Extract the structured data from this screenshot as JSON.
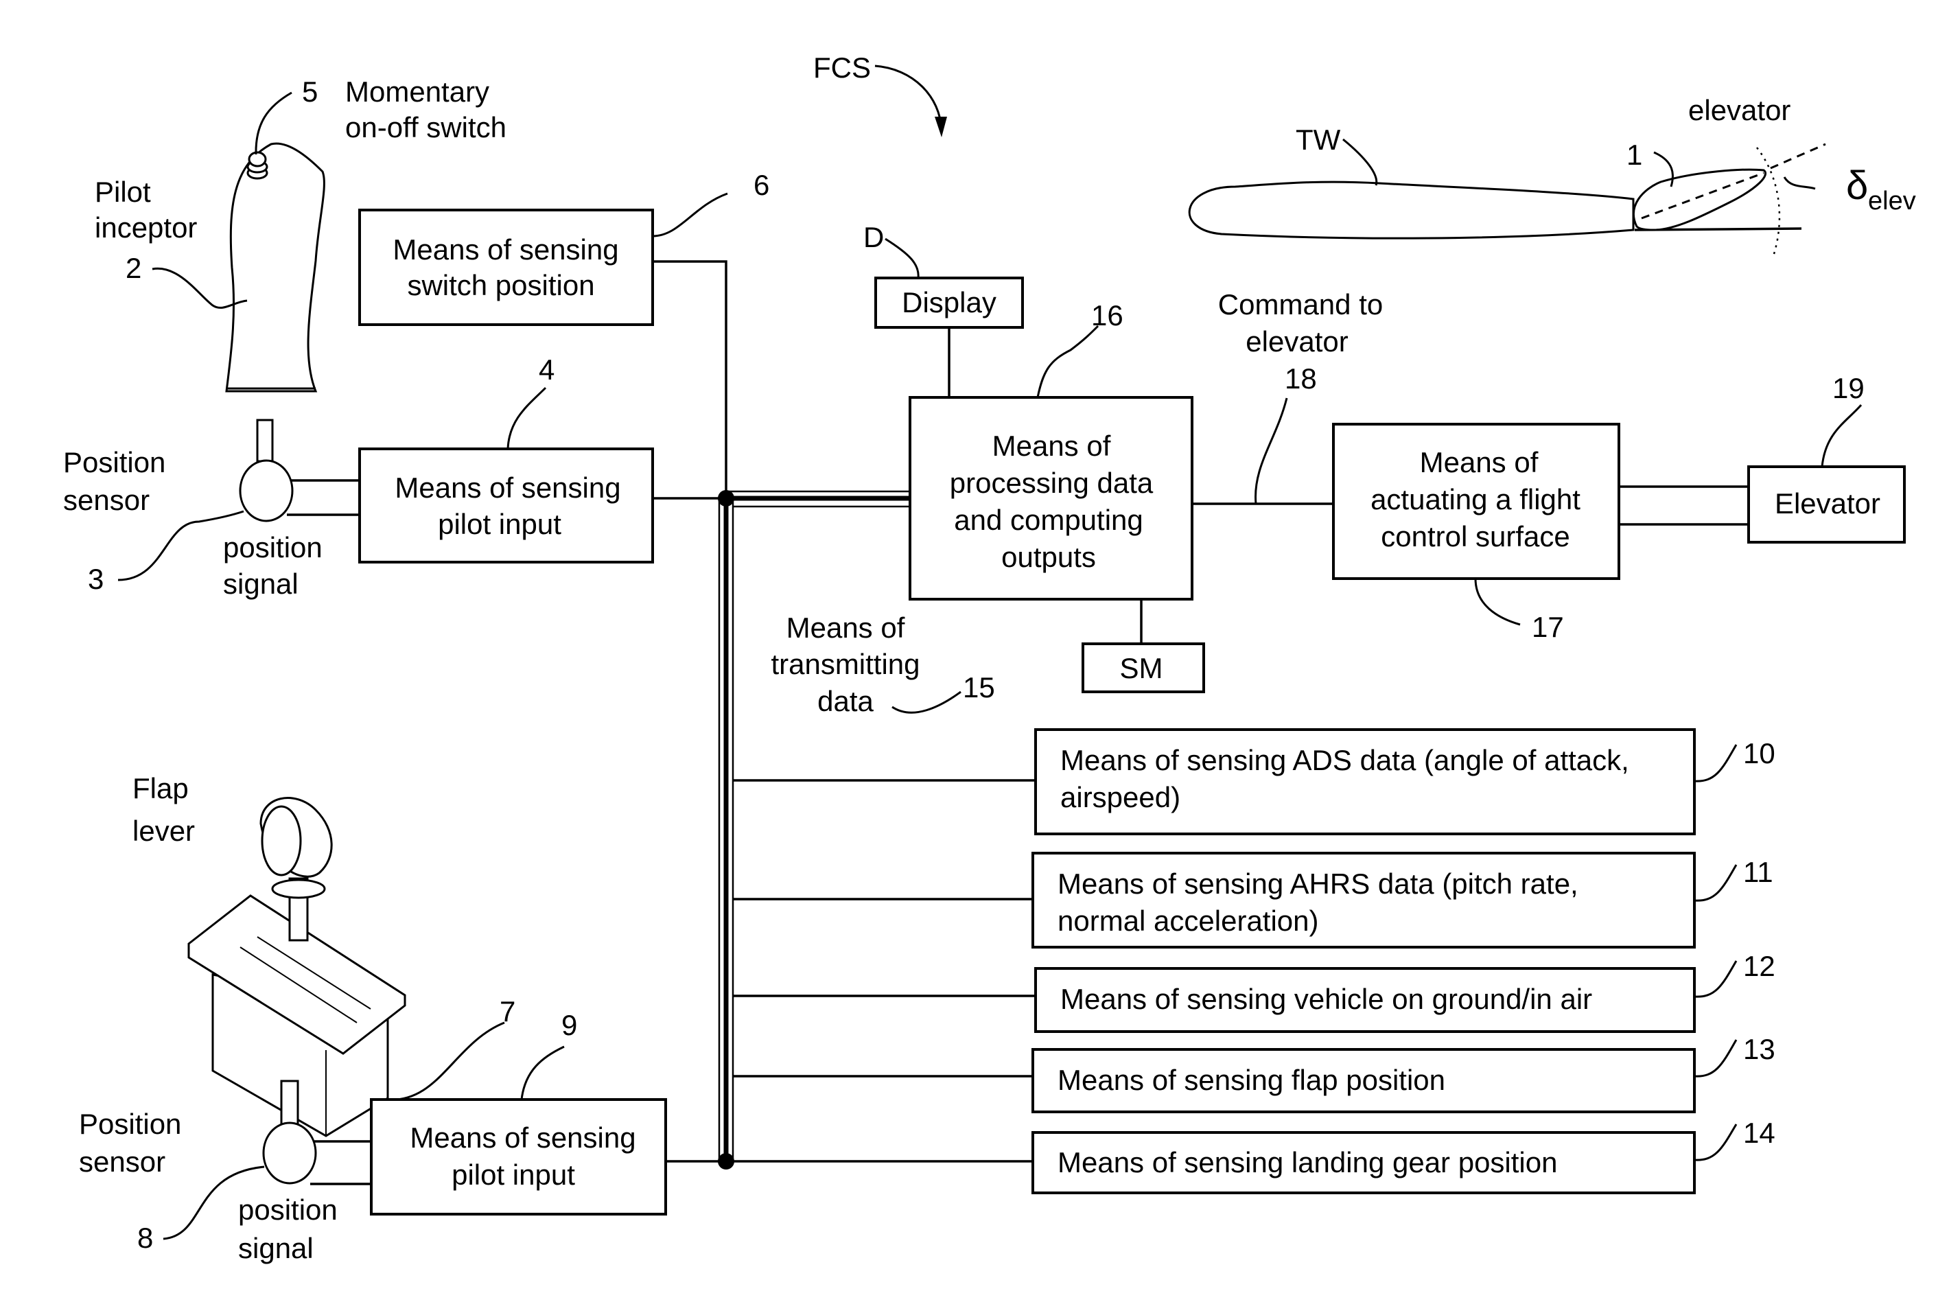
{
  "figure": {
    "system_label": "FCS"
  },
  "pilot_inceptor": {
    "label_line1": "Pilot",
    "label_line2": "inceptor",
    "ref": "2"
  },
  "switch": {
    "ref": "5",
    "label_line1": "Momentary",
    "label_line2": "on-off switch"
  },
  "box_switch_position": {
    "ref": "6",
    "line1": "Means of sensing",
    "line2": "switch position"
  },
  "position_sensor_top": {
    "label_line1": "Position",
    "label_line2": "sensor",
    "ref": "3",
    "signal_line1": "position",
    "signal_line2": "signal"
  },
  "box_pilot_input_top": {
    "ref": "4",
    "line1": "Means of sensing",
    "line2": "pilot input"
  },
  "flap_lever": {
    "label_line1": "Flap",
    "label_line2": "lever",
    "ref": "7"
  },
  "position_sensor_bottom": {
    "label_line1": "Position",
    "label_line2": "sensor",
    "ref": "8",
    "signal_line1": "position",
    "signal_line2": "signal"
  },
  "box_pilot_input_bottom": {
    "ref": "9",
    "line1": "Means of sensing",
    "line2": "pilot input"
  },
  "display": {
    "ref": "D",
    "label": "Display"
  },
  "processing": {
    "ref": "16",
    "line1": "Means of",
    "line2": "processing data",
    "line3": "and computing",
    "line4": "outputs"
  },
  "sm": {
    "label": "SM"
  },
  "transmitting": {
    "ref": "15",
    "line1": "Means of",
    "line2": "transmitting",
    "line3": "data"
  },
  "command": {
    "line1": "Command to",
    "line2": "elevator",
    "ref": "18"
  },
  "actuating": {
    "ref": "17",
    "line1": "Means of",
    "line2": "actuating a flight",
    "line3": "control surface"
  },
  "elevator_box": {
    "ref": "19",
    "label": "Elevator"
  },
  "tail_wing": {
    "label": "TW",
    "elevator_label": "elevator",
    "elevator_ref": "1",
    "deflection_symbol": "δ",
    "deflection_subscript": "elev"
  },
  "sensors": [
    {
      "ref": "10",
      "line1": "Means of sensing ADS data (angle of attack,",
      "line2": "airspeed)"
    },
    {
      "ref": "11",
      "line1": "Means of sensing AHRS data (pitch rate,",
      "line2": "normal acceleration)"
    },
    {
      "ref": "12",
      "line1": "Means of sensing vehicle on ground/in air",
      "line2": ""
    },
    {
      "ref": "13",
      "line1": "Means of sensing flap position",
      "line2": ""
    },
    {
      "ref": "14",
      "line1": "Means of sensing landing gear position",
      "line2": ""
    }
  ]
}
